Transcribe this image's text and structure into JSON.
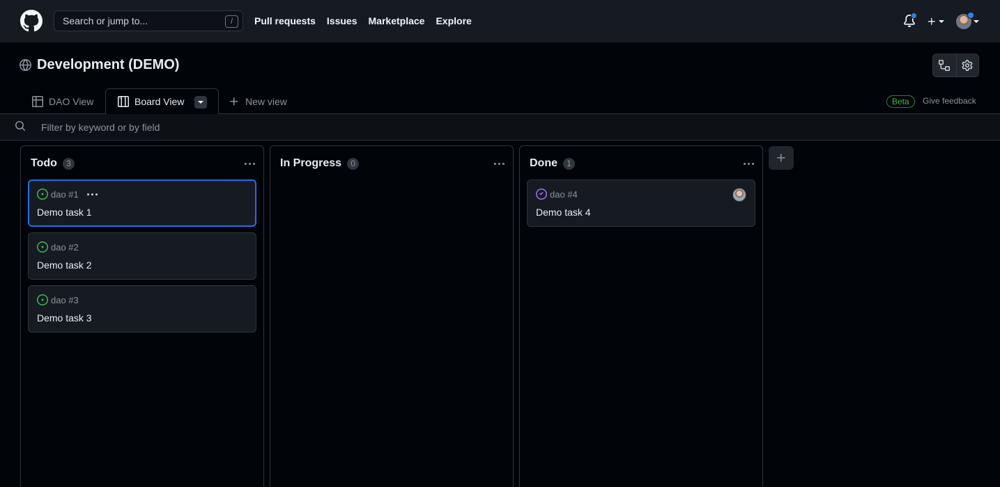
{
  "header": {
    "search_placeholder": "Search or jump to...",
    "search_shortcut": "/",
    "nav": [
      "Pull requests",
      "Issues",
      "Marketplace",
      "Explore"
    ]
  },
  "project": {
    "title": "Development (DEMO)"
  },
  "views": {
    "tabs": [
      {
        "label": "DAO View",
        "icon": "table-icon"
      },
      {
        "label": "Board View",
        "icon": "board-icon",
        "active": true
      },
      {
        "label": "New view",
        "icon": "plus-icon"
      }
    ],
    "beta_label": "Beta",
    "feedback_label": "Give feedback"
  },
  "filter": {
    "placeholder": "Filter by keyword or by field"
  },
  "columns": [
    {
      "name": "Todo",
      "count": "3",
      "cards": [
        {
          "ref": "dao #1",
          "title": "Demo task 1",
          "status": "open"
        },
        {
          "ref": "dao #2",
          "title": "Demo task 2",
          "status": "open"
        },
        {
          "ref": "dao #3",
          "title": "Demo task 3",
          "status": "open"
        }
      ]
    },
    {
      "name": "In Progress",
      "count": "0",
      "cards": []
    },
    {
      "name": "Done",
      "count": "1",
      "cards": [
        {
          "ref": "dao #4",
          "title": "Demo task 4",
          "status": "closed"
        }
      ]
    }
  ],
  "colors": {
    "accent": "#1f6feb",
    "open": "#3fb950",
    "closed": "#a371f7",
    "background": "#010409"
  }
}
